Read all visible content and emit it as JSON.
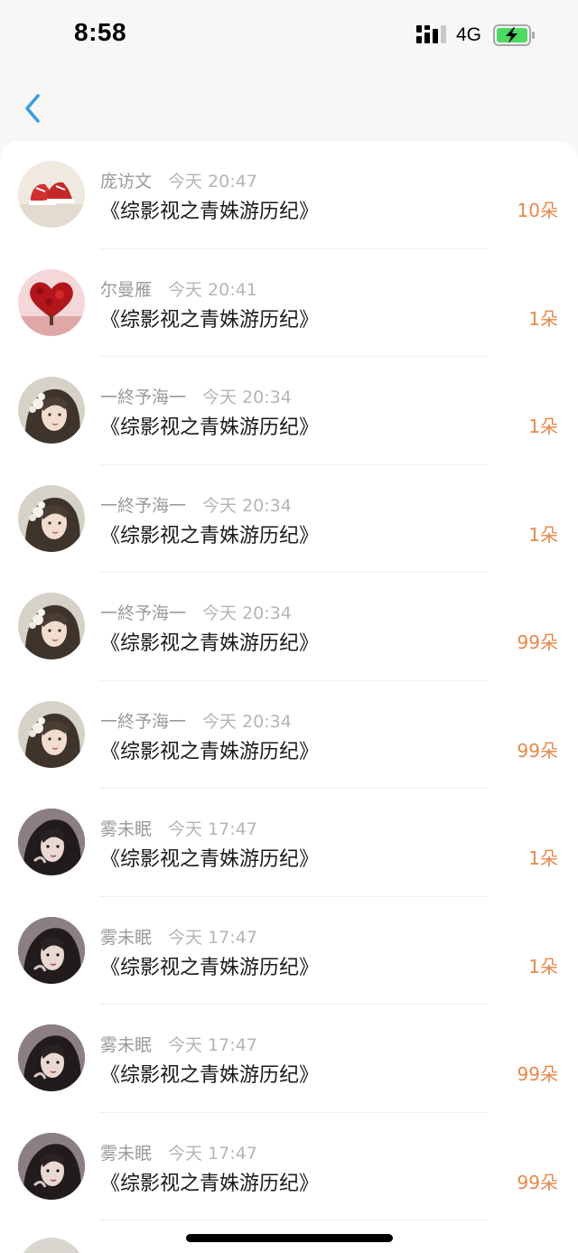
{
  "status_bar": {
    "time": "8:58",
    "network": "4G",
    "battery_charging": true,
    "battery_color": "#4cd964"
  },
  "nav": {
    "back_icon": "chevron-left-icon",
    "accent_color": "#3b9ae1"
  },
  "rows": [
    {
      "name": "庞访文",
      "date": "今天 20:47",
      "title": "《综影视之青姝游历纪》",
      "count": "10朵",
      "avatar": "sneakers"
    },
    {
      "name": "尔曼雁",
      "date": "今天 20:41",
      "title": "《综影视之青姝游历纪》",
      "count": "1朵",
      "avatar": "heart-tree"
    },
    {
      "name": "一終予海一",
      "date": "今天 20:34",
      "title": "《综影视之青姝游历纪》",
      "count": "1朵",
      "avatar": "flower-girl"
    },
    {
      "name": "一終予海一",
      "date": "今天 20:34",
      "title": "《综影视之青姝游历纪》",
      "count": "1朵",
      "avatar": "flower-girl"
    },
    {
      "name": "一終予海一",
      "date": "今天 20:34",
      "title": "《综影视之青姝游历纪》",
      "count": "99朵",
      "avatar": "flower-girl"
    },
    {
      "name": "一終予海一",
      "date": "今天 20:34",
      "title": "《综影视之青姝游历纪》",
      "count": "99朵",
      "avatar": "flower-girl"
    },
    {
      "name": "雾未眠",
      "date": "今天 17:47",
      "title": "《综影视之青姝游历纪》",
      "count": "1朵",
      "avatar": "dark-girl"
    },
    {
      "name": "雾未眠",
      "date": "今天 17:47",
      "title": "《综影视之青姝游历纪》",
      "count": "1朵",
      "avatar": "dark-girl"
    },
    {
      "name": "雾未眠",
      "date": "今天 17:47",
      "title": "《综影视之青姝游历纪》",
      "count": "99朵",
      "avatar": "dark-girl"
    },
    {
      "name": "雾未眠",
      "date": "今天 17:47",
      "title": "《综影视之青姝游历纪》",
      "count": "99朵",
      "avatar": "dark-girl"
    }
  ],
  "colors": {
    "count": "#e8874a",
    "name": "#9a9a9a",
    "title": "#1a1a1a"
  }
}
